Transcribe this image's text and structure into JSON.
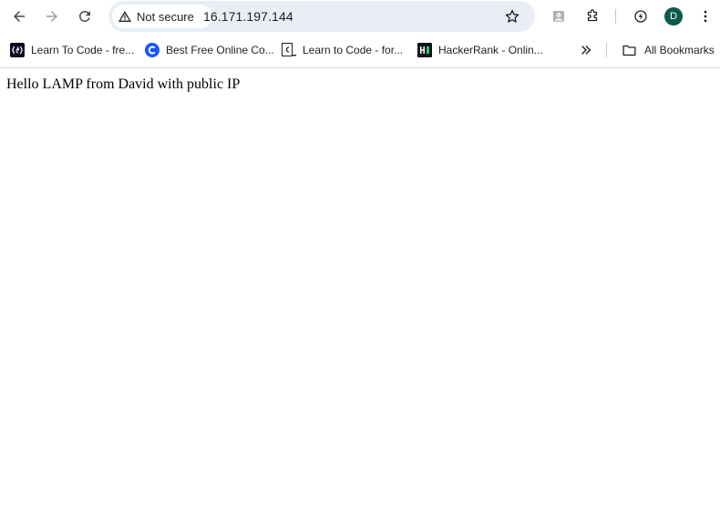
{
  "toolbar": {
    "back_icon": "arrow-left-icon",
    "forward_icon": "arrow-right-icon",
    "reload_icon": "reload-icon",
    "security_label": "Not secure",
    "url": "16.171.197.144",
    "star_icon": "star-icon",
    "extension_icons": [
      "profile-extension-icon",
      "puzzle-icon",
      "performance-icon"
    ],
    "avatar_initial": "D",
    "menu_icon": "more-vertical-icon"
  },
  "bookmarks": {
    "items": [
      {
        "label": "Learn To Code - fre...",
        "icon": "freecodecamp-icon"
      },
      {
        "label": "Best Free Online Co...",
        "icon": "codecademy-icon"
      },
      {
        "label": "Learn to Code - for...",
        "icon": "code-prompt-icon"
      },
      {
        "label": "HackerRank - Onlin...",
        "icon": "hackerrank-icon"
      }
    ],
    "all_bookmarks_label": "All Bookmarks"
  },
  "page": {
    "text": "Hello LAMP from David with public IP"
  },
  "colors": {
    "omnibox_bg": "#e9eef6",
    "avatar_bg": "#0b5b4d",
    "text": "#1f1f1f"
  }
}
